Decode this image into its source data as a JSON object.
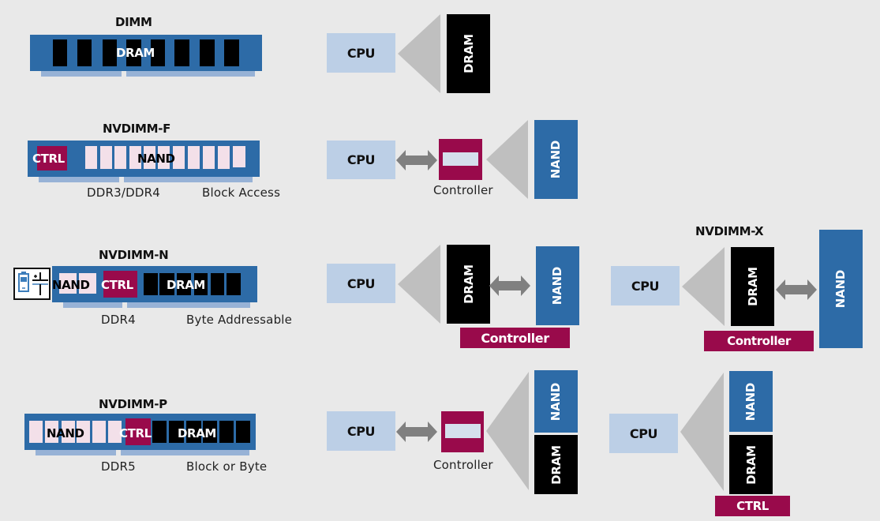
{
  "colors": {
    "background": "#e9e9e9",
    "board_blue": "#2d6ba7",
    "pin_blue": "#97b2d6",
    "dram_black": "#000000",
    "nand_pink": "#f3e0e9",
    "controller_magenta": "#990a4b",
    "cpu_light_blue": "#bccfe6",
    "funnel_gray": "#bfbfbf",
    "arrow_gray": "#808080"
  },
  "modules": {
    "dimm": {
      "title": "DIMM",
      "chip_label": "DRAM"
    },
    "nvdimm_f": {
      "title": "NVDIMM-F",
      "ctrl_label": "CTRL",
      "chip_label": "NAND",
      "interface": "DDR3/DDR4",
      "access": "Block Access"
    },
    "nvdimm_n": {
      "title": "NVDIMM-N",
      "nand_label": "NAND",
      "ctrl_label": "CTRL",
      "dram_label": "DRAM",
      "interface": "DDR4",
      "access": "Byte Addressable",
      "backup_icon": "battery-supercapacitor-icon"
    },
    "nvdimm_p": {
      "title": "NVDIMM-P",
      "nand_label": "NAND",
      "ctrl_label": "CTRL",
      "dram_label": "DRAM",
      "interface": "DDR5",
      "access": "Block or Byte"
    }
  },
  "diagrams": {
    "dimm": {
      "cpu": "CPU",
      "memory": "DRAM"
    },
    "nvdimm_f": {
      "cpu": "CPU",
      "controller": "Controller",
      "memory": "NAND"
    },
    "nvdimm_n": {
      "cpu": "CPU",
      "dram": "DRAM",
      "nand": "NAND",
      "controller": "Controller"
    },
    "nvdimm_x": {
      "title": "NVDIMM-X",
      "cpu": "CPU",
      "dram": "DRAM",
      "nand": "NAND",
      "controller": "Controller"
    },
    "nvdimm_p": {
      "cpu": "CPU",
      "controller": "Controller",
      "nand": "NAND",
      "dram": "DRAM"
    },
    "nvdimm_p_alt": {
      "cpu": "CPU",
      "nand": "NAND",
      "dram": "DRAM",
      "controller": "CTRL"
    }
  }
}
